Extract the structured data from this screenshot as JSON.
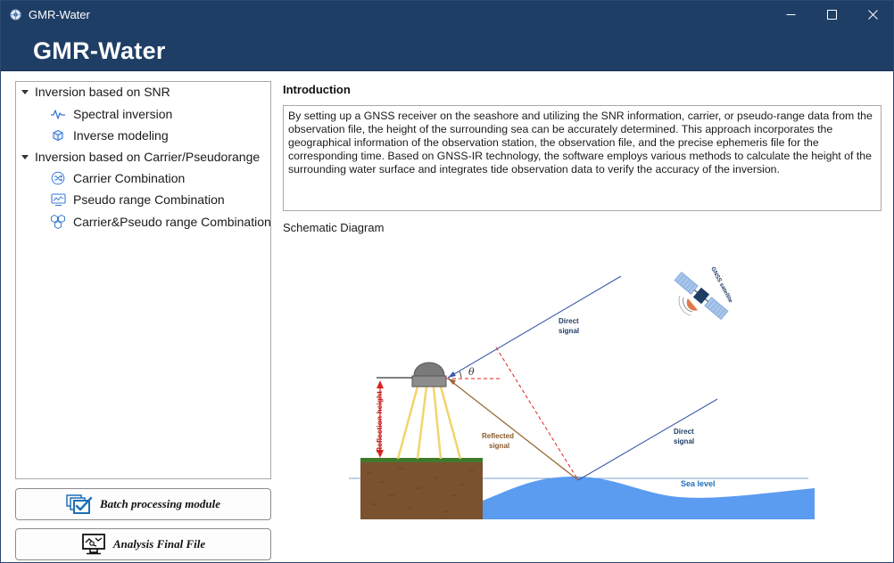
{
  "window": {
    "title": "GMR-Water"
  },
  "header": {
    "app_title": "GMR-Water"
  },
  "tree": {
    "groups": [
      {
        "label": "Inversion based on SNR",
        "items": [
          {
            "label": "Spectral inversion",
            "icon": "waveform-icon"
          },
          {
            "label": "Inverse modeling",
            "icon": "cube-icon"
          }
        ]
      },
      {
        "label": "Inversion based on Carrier/Pseudorange",
        "items": [
          {
            "label": "Carrier Combination",
            "icon": "shuffle-circle-icon"
          },
          {
            "label": "Pseudo range Combination",
            "icon": "chart-monitor-icon"
          },
          {
            "label": "Carrier&Pseudo range Combination",
            "icon": "hexagons-icon"
          }
        ]
      }
    ]
  },
  "buttons": {
    "batch": "Batch processing module",
    "analysis": "Analysis Final File"
  },
  "introduction": {
    "heading": "Introduction",
    "text": "By setting up a GNSS receiver on the seashore and utilizing the SNR information, carrier, or pseudo-range data from the observation file, the height of the surrounding sea can be accurately determined. This approach incorporates the geographical information of the observation station, the observation file, and the precise ephemeris file for the corresponding time. Based on GNSS-IR technology, the software employs various methods to calculate the height of the surrounding water surface and integrates tide observation data to verify the accuracy of the inversion."
  },
  "schematic": {
    "label": "Schematic Diagram",
    "labels": {
      "satellite": "GNSS satellite",
      "direct_signal_1": "Direct signal",
      "direct_signal_2": "Direct signal",
      "reflected_signal": "Reflected signal",
      "reflection_height": "Reflection height",
      "theta": "θ",
      "sea_level": "Sea level"
    },
    "colors": {
      "sea": "#5b9bf0",
      "soil": "#7a5230",
      "grass": "#3f7a2a",
      "signal_line": "#3b5aa8",
      "reflected_line": "#9a6a3a",
      "red_dash": "#e02020",
      "beam": "#f2d46a"
    }
  },
  "colors": {
    "titlebar": "#1f3e66",
    "accent_blue": "#1f6fb8"
  }
}
